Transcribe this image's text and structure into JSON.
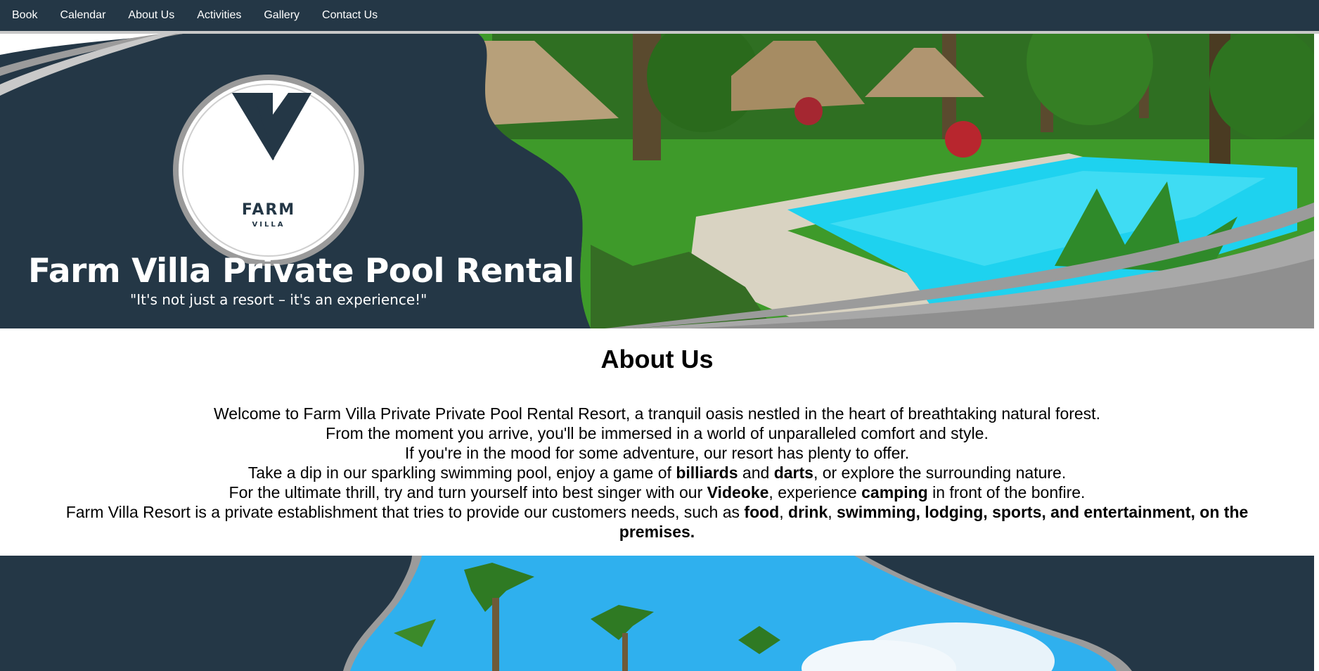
{
  "nav": {
    "items": [
      {
        "label": "Book"
      },
      {
        "label": "Calendar"
      },
      {
        "label": "About Us"
      },
      {
        "label": "Activities"
      },
      {
        "label": "Gallery"
      },
      {
        "label": "Contact Us"
      }
    ]
  },
  "banner": {
    "logo_word": "FARM",
    "logo_subword": "VILLA",
    "title": "Farm Villa Private Pool Rental",
    "tagline": "\"It's not just a resort – it's an experience!\""
  },
  "about": {
    "heading": "About Us",
    "line1": "Welcome to Farm Villa Private Private Pool Rental Resort, a tranquil oasis nestled in the heart of breathtaking natural forest.",
    "line2": "From the moment you arrive, you'll be immersed in a world of unparalleled comfort and style.",
    "line3": "If you're in the mood for some adventure, our resort has plenty to offer.",
    "line4": {
      "a": "Take a dip in our sparkling swimming pool, enjoy a game of ",
      "b1": "billiards",
      "c": " and ",
      "b2": "darts",
      "d": ", or explore the surrounding nature."
    },
    "line5": {
      "a": "For the ultimate thrill, try and turn yourself into best singer with our ",
      "b1": "Videoke",
      "c": ", experience ",
      "b2": "camping",
      "d": " in front of the bonfire."
    },
    "line6": {
      "a": "Farm Villa Resort is a private establishment that tries to provide our customers needs, such as ",
      "b1": "food",
      "c": ", ",
      "b2": "drink",
      "d": ", ",
      "b3": "swimming, lodging, sports, and entertainment, on the premises."
    }
  },
  "colors": {
    "navy": "#243746",
    "pool": "#1ed2ef",
    "grass": "#3e9a2a",
    "sky": "#2fb0ee",
    "silver": "#a8a8a8"
  }
}
